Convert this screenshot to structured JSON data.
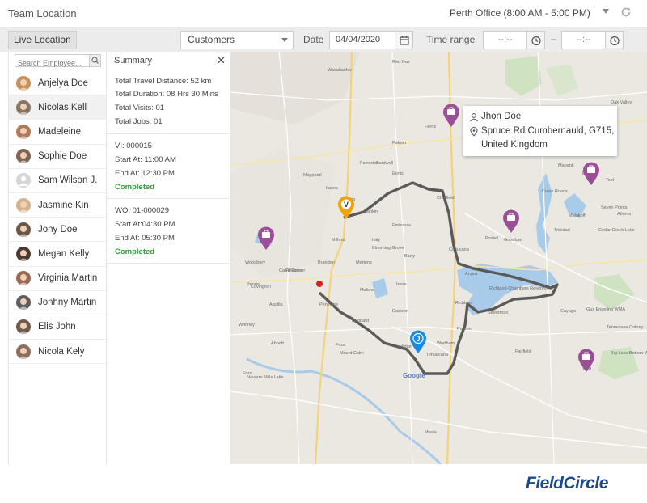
{
  "header": {
    "title": "Team Location",
    "office": "Perth Office (8:00 AM - 5:00 PM)"
  },
  "toolbar": {
    "live_location_label": "Live Location",
    "customer_filter": "Customers",
    "date_label": "Date",
    "date_value": "04/04/2020",
    "time_range_label": "Time range",
    "time_from": "--:--",
    "time_to": "--:--",
    "dash": "–"
  },
  "employees": {
    "search_placeholder": "Search Employee...",
    "items": [
      {
        "name": "Anjelya Doe",
        "active": false
      },
      {
        "name": "Nicolas Kell",
        "active": true
      },
      {
        "name": "Madeleine",
        "active": false
      },
      {
        "name": "Sophie Doe",
        "active": false
      },
      {
        "name": "Sam Wilson J.",
        "active": false
      },
      {
        "name": "Jasmine Kin",
        "active": false
      },
      {
        "name": "Jony Doe",
        "active": false
      },
      {
        "name": "Megan Kelly",
        "active": false
      },
      {
        "name": "Virginia Martin",
        "active": false
      },
      {
        "name": "Jonhny Martin",
        "active": false
      },
      {
        "name": "Elis John",
        "active": false
      },
      {
        "name": "Nicola Kely",
        "active": false
      }
    ]
  },
  "summary": {
    "title": "Summary",
    "close": "✕",
    "total_travel_distance": "Total Travel Distance: 52 km",
    "total_duration": "Total Duration: 08 Hrs 30 Mins",
    "total_visits": "Total Visits: 01",
    "total_jobs": "Total Jobs: 01",
    "visits": [
      {
        "id": "VI: 000015",
        "start": "Start At: 11:00 AM",
        "end": "End At: 12:30 PM",
        "status": "Completed"
      },
      {
        "id": "WO: 01-000029",
        "start": "Start At:04:30 PM",
        "end": "End At: 05:30 PM",
        "status": "Completed"
      }
    ]
  },
  "map": {
    "popup_name": "Jhon Doe",
    "popup_address_1": "Spruce Rd Cumbernauld, G715,",
    "popup_address_2": "United Kingdom",
    "marker_v": "V",
    "marker_j": "J",
    "google_label": "Google",
    "place_labels": [
      "Ennis",
      "Rankin",
      "Chatfield",
      "Powell",
      "Goodlow",
      "Trinidad",
      "Kemp",
      "Corsicana",
      "Emhouse",
      "Angus",
      "Richland",
      "Streetman",
      "Fairfield",
      "Wortham",
      "Mexia",
      "Dawson",
      "Hubbard",
      "Purdon",
      "Frost",
      "Milford",
      "Italy",
      "Blooming Grove",
      "Barry",
      "Mertens",
      "Brandon",
      "Irene",
      "Malone",
      "Penelope",
      "Mount Calm",
      "Coolidge",
      "Tehuacana",
      "Woodbury",
      "Covington",
      "Peoria",
      "Whitney",
      "Aquilla",
      "Abbott",
      "Hillsboro",
      "Itasca",
      "Carl's Corner",
      "Mabank",
      "Eustace",
      "Athens",
      "Malakoff",
      "Cross Roads",
      "Tool",
      "Seven Points",
      "Cayuga",
      "Tennessee Colony",
      "Big Lake Bottom WMA",
      "Yard",
      "Cedar Creek Lake",
      "Gus Engeling WMA",
      "Navarro Mills Lake",
      "Richland-Chambers Reservoir",
      "Waxahachie",
      "Red Oak",
      "Ferris",
      "Palmer",
      "Bardwell",
      "Forreston",
      "Maypearl",
      "Frost",
      "Kerens",
      "Oak Valley"
    ],
    "accent_route": "#555555",
    "pin_purple": "#9b4f96",
    "pin_orange": "#f0a30a",
    "pin_blue": "#1a8be0"
  },
  "footer": {
    "logo": "FieldCircle"
  }
}
